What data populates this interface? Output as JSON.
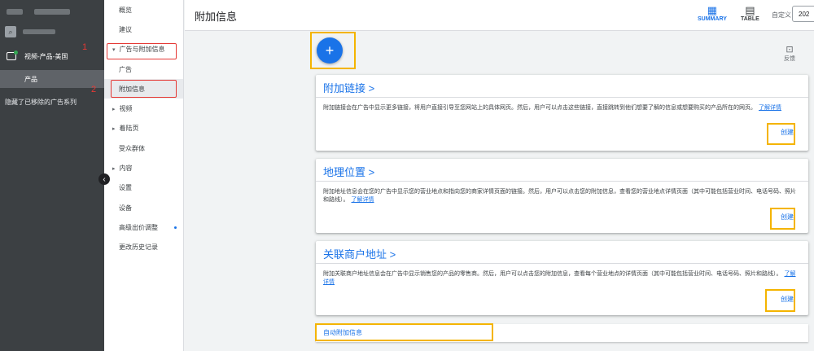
{
  "sidebar_left": {
    "campaign_name": "视频-产品-美国",
    "ad_group": "产品",
    "hidden_removed": "隐藏了已移除的广告系列",
    "marker_1": "1",
    "marker_2": "2"
  },
  "nav": {
    "items": [
      {
        "label": "概览"
      },
      {
        "label": "建议"
      },
      {
        "label": "广告与附加信息"
      },
      {
        "label": "广告"
      },
      {
        "label": "附加信息"
      },
      {
        "label": "视频"
      },
      {
        "label": "着陆页"
      },
      {
        "label": "受众群体"
      },
      {
        "label": "内容"
      },
      {
        "label": "设置"
      },
      {
        "label": "设备"
      },
      {
        "label": "高级出价调整"
      },
      {
        "label": "更改历史记录"
      }
    ]
  },
  "header": {
    "title": "附加信息",
    "summary_label": "SUMMARY",
    "table_label": "TABLE",
    "custom_label": "自定义",
    "date_value": "202"
  },
  "main": {
    "fab_label": "+",
    "feedback_label": "反馈",
    "cards": [
      {
        "title": "附加链接 >",
        "desc": "附加链接会在广告中显示更多链接，将用户直接引导至您网站上的具体网页。然后，用户可以点击这些链接，直接跳转到他们想要了解的信息或想要购买的产品所在的网页。",
        "learn_more": "了解详情",
        "create": "创建"
      },
      {
        "title": "地理位置 >",
        "desc": "附加地址信息会在您的广告中显示您的营业地点和指向您的商家详情页面的链接。然后，用户可以点击您的附加信息，查看您的营业地点详情页面（其中可能包括营业时间、电话号码、照片和路线）。",
        "learn_more": "了解详情",
        "create": "创建"
      },
      {
        "title": "关联商户地址 >",
        "desc": "附加关联商户地址信息会在广告中显示销售您的产品的零售商。然后，用户可以点击您的附加信息，查看每个营业地点的详情页面（其中可能包括营业时间、电话号码、照片和路线）。",
        "learn_more": "了解详情",
        "create": "创建"
      }
    ],
    "auto_extensions": "自动附加信息"
  }
}
